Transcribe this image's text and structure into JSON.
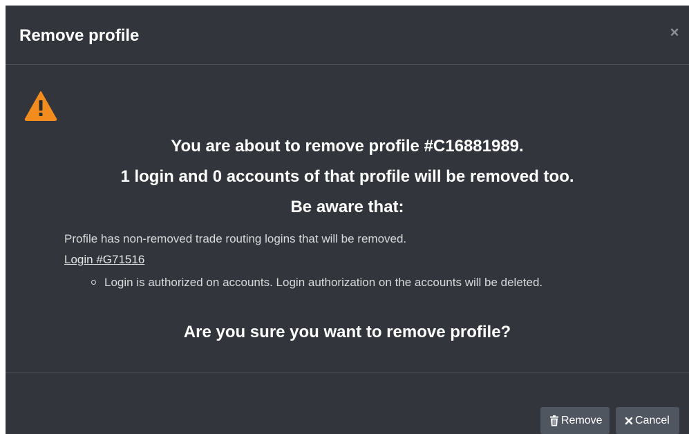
{
  "dialog": {
    "title": "Remove profile",
    "close_label": "×"
  },
  "body": {
    "line1": "You are about to remove profile #C16881989.",
    "line2": "1 login and 0 accounts of that profile will be removed too.",
    "line3": "Be aware that:",
    "detail": "Profile has non-removed trade routing logins that will be removed.",
    "login_link": "Login #G71516",
    "sub_items": [
      "Login is authorized on accounts. Login authorization on the accounts will be deleted."
    ],
    "question": "Are you sure you want to remove profile?"
  },
  "footer": {
    "remove_label": "Remove",
    "cancel_label": "Cancel"
  },
  "icons": {
    "warning": "warning-triangle-icon",
    "trash": "trash-icon",
    "close": "close-icon"
  },
  "colors": {
    "background": "#32353b",
    "warning": "#f28c1e",
    "button": "#4f5660"
  }
}
